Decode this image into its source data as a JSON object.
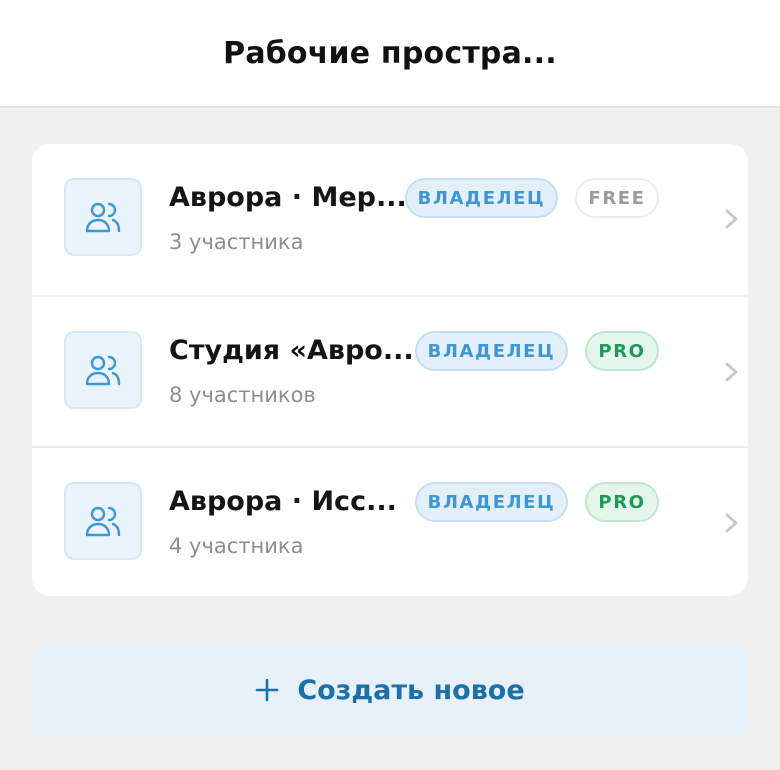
{
  "header": {
    "title": "Рабочие простра..."
  },
  "workspaces": [
    {
      "name": "Аврора · Мер...",
      "members": "3 участника",
      "role_badge": "ВЛАДЕЛЕЦ",
      "plan_badge": "FREE",
      "plan": "free"
    },
    {
      "name": "Студия «Авро...",
      "members": "8 участников",
      "role_badge": "ВЛАДЕЛЕЦ",
      "plan_badge": "PRO",
      "plan": "pro"
    },
    {
      "name": "Аврора · Исс...",
      "members": "4 участника",
      "role_badge": "ВЛАДЕЛЕЦ",
      "plan_badge": "PRO",
      "plan": "pro"
    }
  ],
  "actions": {
    "create_label": "Создать новое"
  },
  "icons": {
    "workspace": "users-icon",
    "row_arrow": "chevron-right-icon",
    "create": "plus-icon"
  },
  "colors": {
    "accent": "#3d97d4",
    "accent_dark": "#1c6fa8",
    "pro_green": "#1f9a56",
    "free_gray": "#9c9c9c",
    "background": "#f0f0f0"
  }
}
